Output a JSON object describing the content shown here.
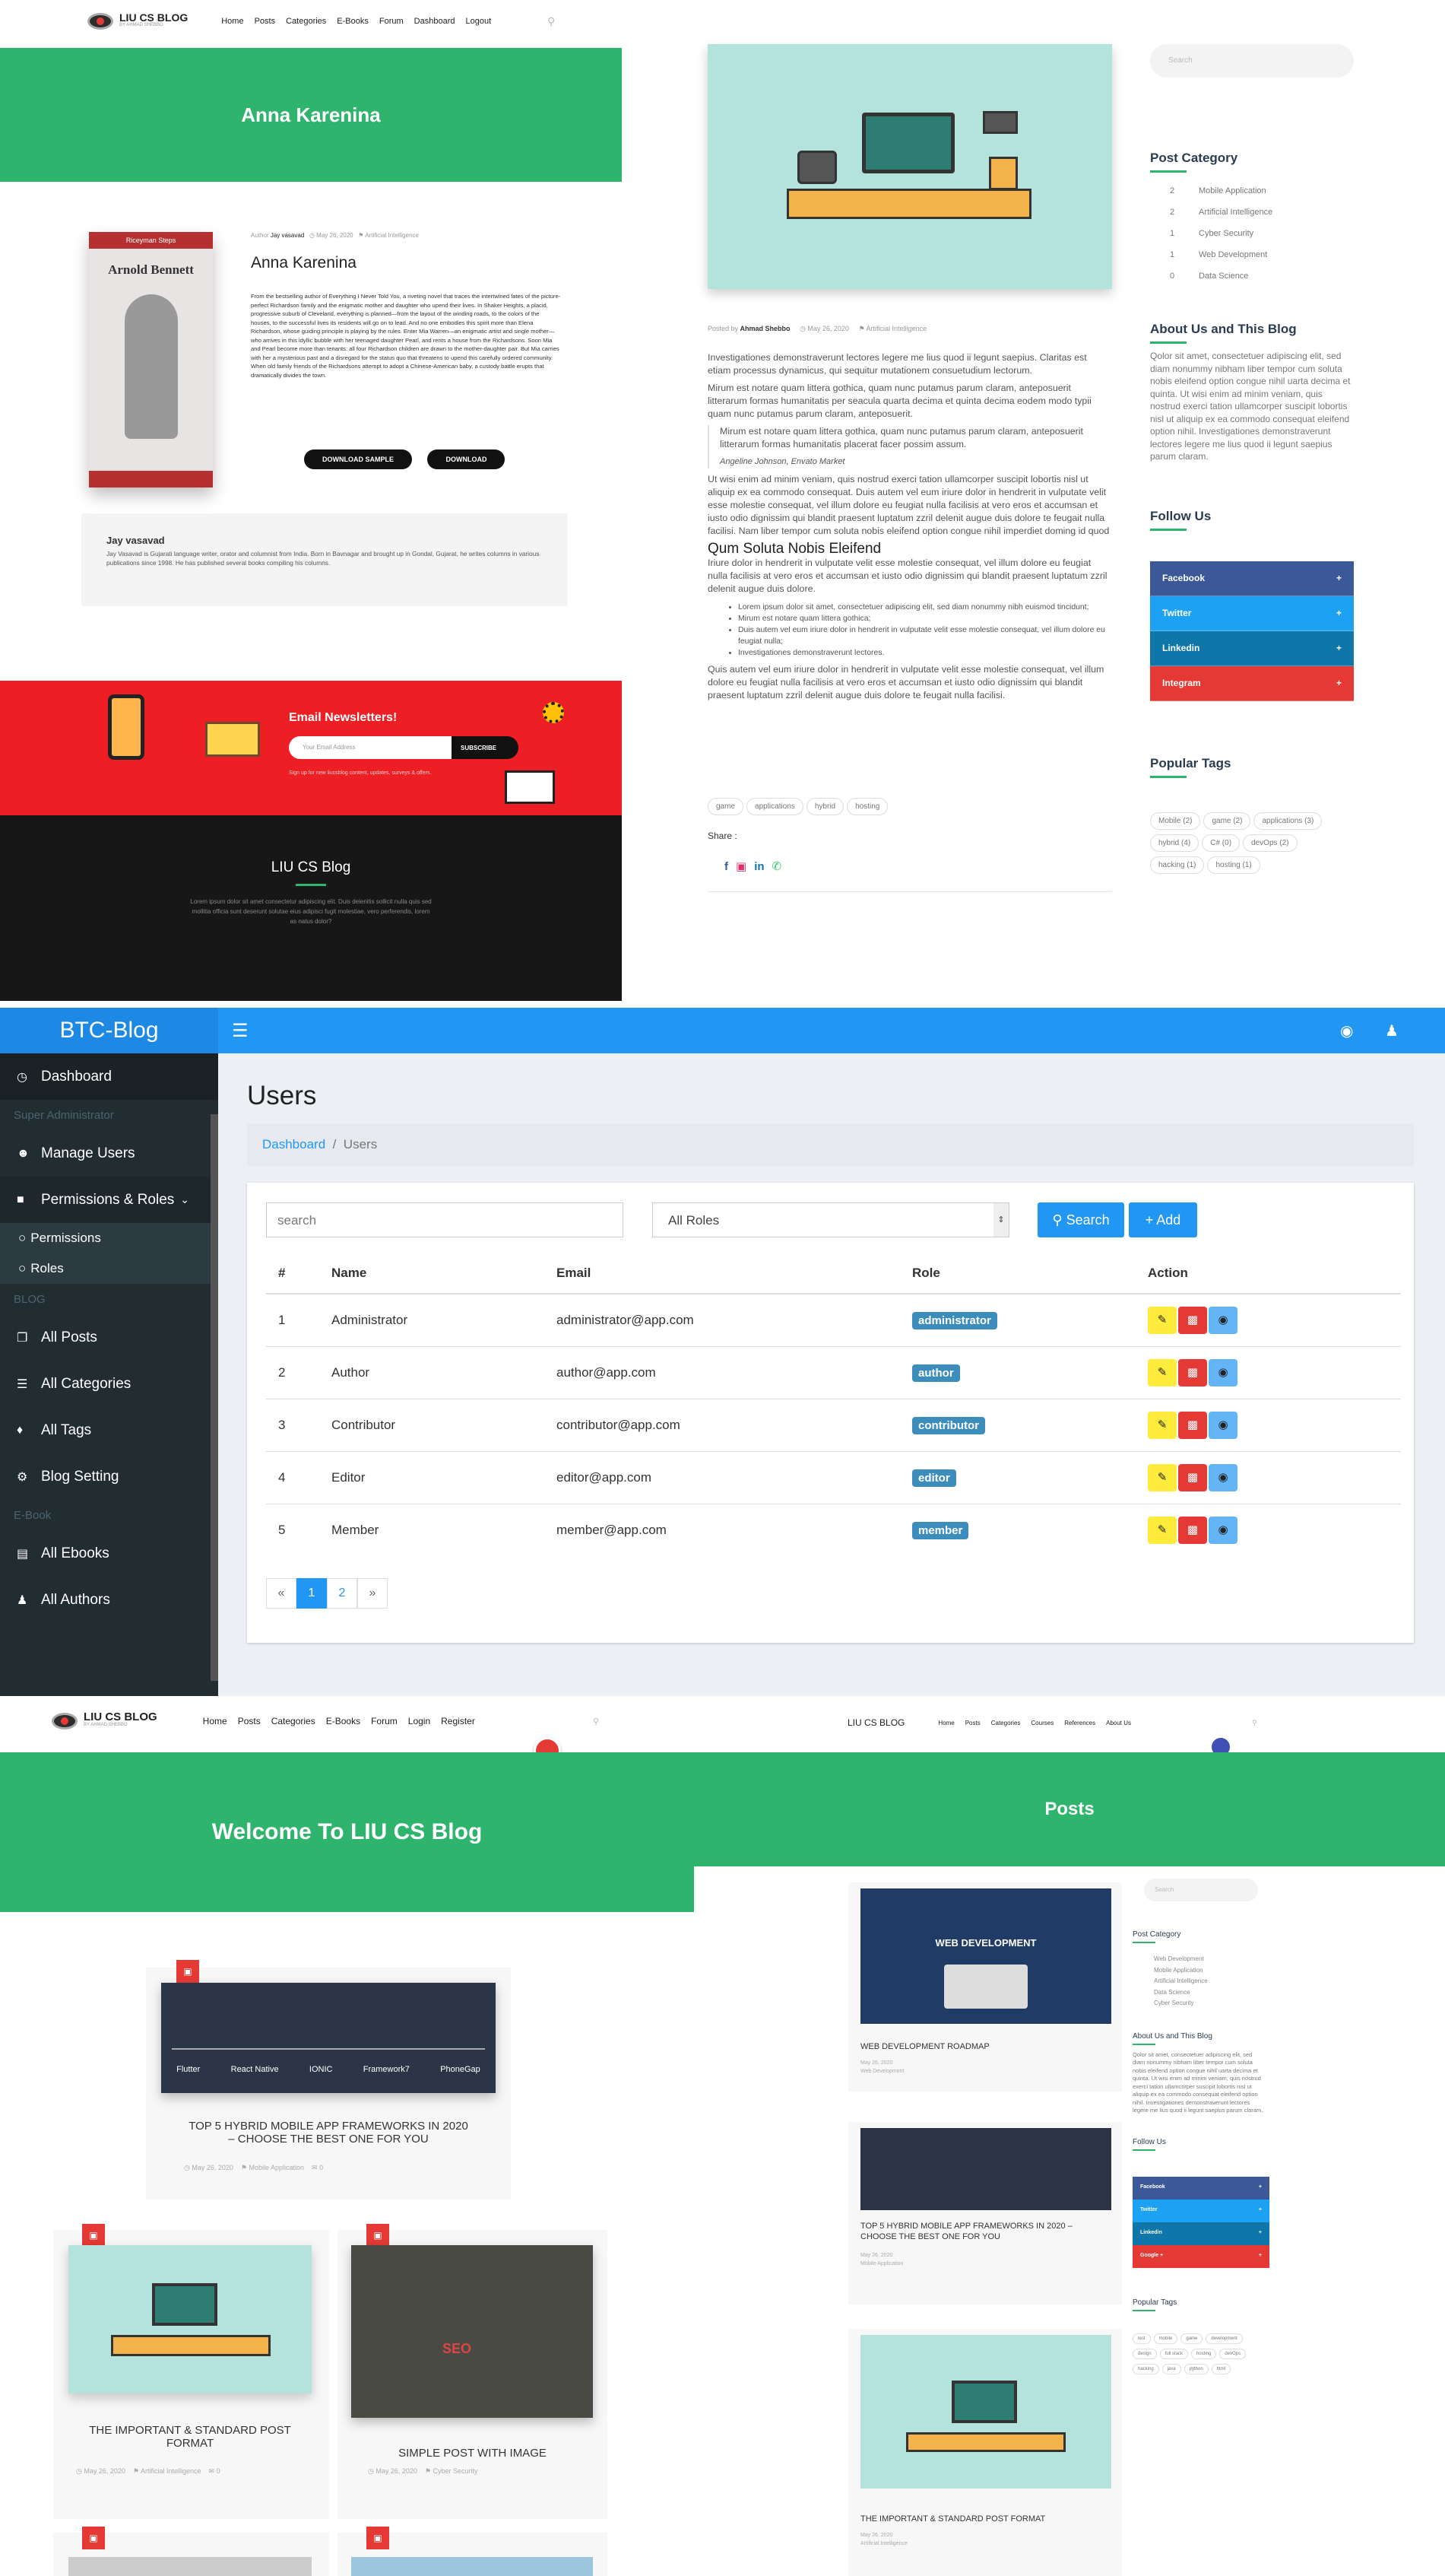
{
  "blog1": {
    "logo": "LIU CS BLOG",
    "logo_sub": "BY AHMAD SHEBBO",
    "nav": [
      "Home",
      "Posts",
      "Categories",
      "E-Books",
      "Forum",
      "Dashboard",
      "Logout"
    ],
    "banner_title": "Anna Karenina",
    "book_cover_top": "Arnold Bennett",
    "book_cover_sub": "Riceyman Steps",
    "author_label": "Author",
    "author": "Jay vasavad",
    "date": "May 26, 2020",
    "category": "Artificial Intelligence",
    "book_title": "Anna Karenina",
    "book_desc": "From the bestselling author of Everything I Never Told You, a riveting novel that traces the intertwined fates of the picture-perfect Richardson family and the enigmatic mother and daughter who upend their lives. In Shaker Heights, a placid, progressive suburb of Cleveland, everything is planned—from the layout of the winding roads, to the colors of the houses, to the successful lives its residents will go on to lead. And no one embodies this spirit more than Elena Richardson, whose guiding principle is playing by the rules. Enter Mia Warren—an enigmatic artist and single mother—who arrives in this idyllic bubble with her teenaged daughter Pearl, and rents a house from the Richardsons. Soon Mia and Pearl become more than tenants: all four Richardson children are drawn to the mother-daughter pair. But Mia carries with her a mysterious past and a disregard for the status quo that threatens to upend this carefully ordered community. When old family friends of the Richardsons attempt to adopt a Chinese-American baby, a custody battle erupts that dramatically divides the town.",
    "download_sample": "DOWNLOAD SAMPLE",
    "download": "DOWNLOAD",
    "author_box_name": "Jay vasavad",
    "author_box_bio": "Jay Vasavad is Gujarati language writer, orator and columnist from India. Born in Bavnagar and brought up in Gondal, Gujarat, he writes columns in various publications since 1998. He has published several books compiling his columns.",
    "newsletter_title": "Email Newsletters!",
    "email_placeholder": "Your Email Address",
    "subscribe": "SUBSCRIBE",
    "newsletter_note": "Sign up for new liucsblog content, updates, surveys & offers.",
    "footer_title": "LIU CS Blog",
    "footer_text": "Lorem ipsum dolor sit amet consectetur adipiscing elit. Duis delenitis sollicit nulla quis sed mollitia officia sunt deserunt solutae eius adipisci fugit molestiae, vero perferendis, lorem as natus dolor?"
  },
  "post": {
    "posted_by_label": "Posted by",
    "posted_by": "Ahmad Shebbo",
    "date": "May 26, 2020",
    "category": "Artificial Intelligence",
    "p1": "Investigationes demonstraverunt lectores legere me lius quod ii legunt saepius. Claritas est etiam processus dynamicus, qui sequitur mutationem consuetudium lectorum.",
    "p2": "Mirum est notare quam littera gothica, quam nunc putamus parum claram, anteposuerit litterarum formas humanitatis per seacula quarta decima et quinta decima eodem modo typii quam nunc putamus parum claram, anteposuerit.",
    "quote": "Mirum est notare quam littera gothica, quam nunc putamus parum claram, anteposuerit litterarum formas humanitatis placerat facer possim assum.",
    "quote_by": "Angeline Johnson, Envato Market",
    "p3": "Ut wisi enim ad minim veniam, quis nostrud exerci tation ullamcorper suscipit lobortis nisl ut aliquip ex ea commodo consequat. Duis autem vel eum iriure dolor in hendrerit in vulputate velit esse molestie consequat, vel illum dolore eu feugiat nulla facilisis at vero eros et accumsan et iusto odio dignissim qui blandit praesent luptatum zzril delenit augue duis dolore te feugait nulla facilisi. Nam liber tempor cum soluta nobis eleifend option congue nihil imperdiet doming id quod mazim placerat facer possim assum.",
    "h2": "Qum Soluta Nobis Eleifend",
    "p4": "Iriure dolor in hendrerit in vulputate velit esse molestie consequat, vel illum dolore eu feugiat nulla facilisis at vero eros et accumsan et iusto odio dignissim qui blandit praesent luptatum zzril delenit augue duis dolore.",
    "bullets": [
      "Lorem ipsum dolor sit amet, consectetuer adipiscing elit, sed diam nonummy nibh euismod tincidunt;",
      "Mirum est notare quam littera gothica;",
      "Duis autem vel eum iriure dolor in hendrerit in vulputate velit esse molestie consequat, vel illum dolore eu feugiat nulla;",
      "Investigationes demonstraverunt lectores."
    ],
    "p5": "Quis autem vel eum iriure dolor in hendrerit in vulputate velit esse molestie consequat, vel illum dolore eu feugiat nulla facilisis at vero eros et accumsan et iusto odio dignissim qui blandit praesent luptatum zzril delenit augue duis dolore te feugait nulla facilisi.",
    "tags": [
      "game",
      "applications",
      "hybrid",
      "hosting"
    ],
    "share": "Share :"
  },
  "sidebar1": {
    "search_placeholder": "Search",
    "cat_title": "Post Category",
    "cats": [
      {
        "n": "2",
        "name": "Mobile Application"
      },
      {
        "n": "2",
        "name": "Artificial Intelligence"
      },
      {
        "n": "1",
        "name": "Cyber Security"
      },
      {
        "n": "1",
        "name": "Web Development"
      },
      {
        "n": "0",
        "name": "Data Science"
      }
    ],
    "about_title": "About Us and This Blog",
    "about": "Qolor sit amet, consectetuer adipiscing elit, sed diam nonummy nibham liber tempor cum soluta nobis eleifend option congue nihil uarta decima et quinta. Ut wisi enim ad minim veniam, quis nostrud exerci tation ullamcorper suscipit lobortis nisl ut aliquip ex ea commodo consequat eleifend option nihil. Investigationes demonstraverunt lectores legere me lius quod ii legunt saepius parum claram.",
    "follow_title": "Follow Us",
    "follow": [
      {
        "name": "Facebook",
        "color": "#3b5998"
      },
      {
        "name": "Twitter",
        "color": "#1da1f2"
      },
      {
        "name": "Linkedin",
        "color": "#0e76a8"
      },
      {
        "name": "Integram",
        "color": "#e53935"
      }
    ],
    "tags_title": "Popular Tags",
    "tags": [
      "Mobile (2)",
      "game (2)",
      "applications (3)",
      "hybrid (4)",
      "C# (0)",
      "devOps (2)",
      "hacking (1)",
      "hosting (1)"
    ]
  },
  "admin": {
    "brand": "BTC-Blog",
    "menu": {
      "dashboard": "Dashboard",
      "super_admin": "Super Administrator",
      "manage_users": "Manage Users",
      "perm_roles": "Permissions & Roles",
      "permissions": "Permissions",
      "roles": "Roles",
      "blog": "BLOG",
      "all_posts": "All Posts",
      "all_categories": "All Categories",
      "all_tags": "All Tags",
      "blog_setting": "Blog Setting",
      "ebook": "E-Book",
      "all_ebooks": "All Ebooks",
      "all_authors": "All Authors"
    },
    "page_title": "Users",
    "breadcrumb": [
      "Dashboard",
      "Users"
    ],
    "search_placeholder": "search",
    "roles_select": "All Roles",
    "search_btn": "Search",
    "add_btn": "Add",
    "columns": [
      "#",
      "Name",
      "Email",
      "Role",
      "Action"
    ],
    "rows": [
      {
        "id": "1",
        "name": "Administrator",
        "email": "administrator@app.com",
        "role": "administrator"
      },
      {
        "id": "2",
        "name": "Author",
        "email": "author@app.com",
        "role": "author"
      },
      {
        "id": "3",
        "name": "Contributor",
        "email": "contributor@app.com",
        "role": "contributor"
      },
      {
        "id": "4",
        "name": "Editor",
        "email": "editor@app.com",
        "role": "editor"
      },
      {
        "id": "5",
        "name": "Member",
        "email": "member@app.com",
        "role": "member"
      }
    ],
    "pager": [
      "«",
      "1",
      "2",
      "»"
    ]
  },
  "home": {
    "logo": "LIU CS BLOG",
    "logo_sub": "BY AHMAD SHEBBO",
    "nav": [
      "Home",
      "Posts",
      "Categories",
      "E-Books",
      "Forum",
      "Login",
      "Register"
    ],
    "banner": "Welcome To LIU CS Blog",
    "frameworks": [
      "Flutter",
      "React Native",
      "IONIC",
      "Framework7",
      "PhoneGap"
    ],
    "post1": "TOP 5 HYBRID MOBILE APP FRAMEWORKS IN 2020 – CHOOSE THE BEST ONE FOR YOU",
    "post1_meta": [
      "May 26, 2020",
      "Mobile Application",
      "0"
    ],
    "post2": "THE IMPORTANT & STANDARD POST FORMAT",
    "post2_meta": [
      "May 26, 2020",
      "Artificial Intelligence",
      "0"
    ],
    "post3": "SIMPLE POST WITH IMAGE",
    "post3_meta": [
      "May 26, 2020",
      "Cyber Security"
    ],
    "seo": "SEO"
  },
  "posts": {
    "logo": "LIU CS BLOG",
    "nav": [
      "Home",
      "Posts",
      "Categories",
      "Courses",
      "References",
      "About Us"
    ],
    "banner": "Posts",
    "search_placeholder": "Search",
    "web_dev_label": "WEB DEVELOPMENT",
    "p1": "WEB DEVELOPMENT ROADMAP",
    "p1_meta": [
      "May 26, 2020",
      "Web Development"
    ],
    "p2": "TOP 5 HYBRID MOBILE APP FRAMEWORKS IN 2020 – CHOOSE THE BEST ONE FOR YOU",
    "p2_meta": [
      "May 26, 2020",
      "Mobile Application"
    ],
    "p3": "THE IMPORTANT & STANDARD POST FORMAT",
    "p3_meta": [
      "May 26, 2020",
      "Artificial Intelligence"
    ],
    "cat_title": "Post Category",
    "cats": [
      "Web Development",
      "Mobile Application",
      "Artificial Intelligence",
      "Data Science",
      "Cyber Security"
    ],
    "about_title": "About Us and This Blog",
    "about": "Qolor sit amet, consectetuer adipiscing elit, sed diam nonummy nibham liber tempor cum soluta nobis eleifend option congue nihil uarta decima et quinta. Ut wisi enim ad minim veniam, quis nostrud exerci tation ullamcorper suscipit lobortis nisl ut aliquip ex ea commodo consequat eleifend option nihil. Investigationes demonstraverunt lectores legere me lius quod ii legunt saepius parum claram.",
    "follow_title": "Follow Us",
    "follow": [
      "Facebook",
      "Twitter",
      "Linkedin",
      "Google +"
    ],
    "tags_title": "Popular Tags",
    "tags": [
      "test",
      "mobile",
      "game",
      "development",
      "design",
      "full stack",
      "hosting",
      "devOps",
      "hacking",
      "java",
      "python",
      "html"
    ]
  }
}
